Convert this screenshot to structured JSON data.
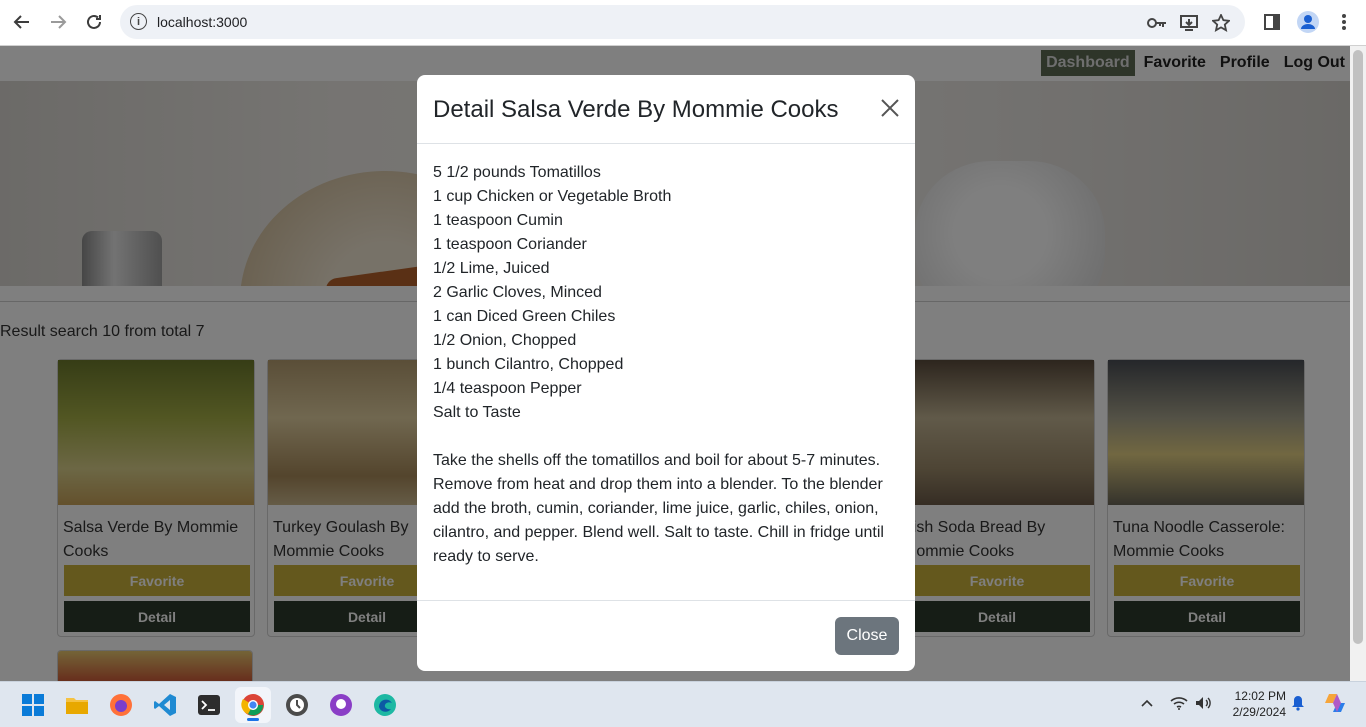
{
  "browser": {
    "url": "localhost:3000",
    "icons": {
      "back": "arrow-left-icon",
      "forward": "arrow-right-icon",
      "reload": "reload-icon",
      "info": "info-icon",
      "key": "key-icon",
      "install": "install-app-icon",
      "bookmark": "star-icon",
      "sidepanel": "side-panel-icon",
      "profile": "profile-icon",
      "menu": "kebab-menu-icon"
    }
  },
  "nav": {
    "items": [
      {
        "label": "Dashboard",
        "active": true
      },
      {
        "label": "Favorite",
        "active": false
      },
      {
        "label": "Profile",
        "active": false
      },
      {
        "label": "Log Out",
        "active": false
      }
    ]
  },
  "results": {
    "text": "Result search 10 from total 7"
  },
  "cards": [
    {
      "title": "Salsa Verde By Mommie Cooks",
      "favorite": "Favorite",
      "detail": "Detail",
      "thumb_color": "#8a9a3a"
    },
    {
      "title": "Turkey Goulash By Mommie Cooks",
      "favorite": "Favorite",
      "detail": "Detail",
      "thumb_color": "#c9b488"
    },
    {
      "title": "Irish Soda Bread By Mommie Cooks",
      "favorite": "Favorite",
      "detail": "Detail",
      "thumb_color": "#8a7c68"
    },
    {
      "title": "Tuna Noodle Casserole: Mommie Cooks",
      "favorite": "Favorite",
      "detail": "Detail",
      "thumb_color": "#b8a878"
    }
  ],
  "modal": {
    "title": "Detail Salsa Verde By Mommie Cooks",
    "ingredients": [
      "5 1/2 pounds Tomatillos",
      "1 cup Chicken or Vegetable Broth",
      "1 teaspoon Cumin",
      "1 teaspoon Coriander",
      "1/2 Lime, Juiced",
      "2 Garlic Cloves, Minced",
      "1 can Diced Green Chiles",
      "1/2 Onion, Chopped",
      "1 bunch Cilantro, Chopped",
      "1/4 teaspoon Pepper",
      "Salt to Taste"
    ],
    "instructions": "Take the shells off the tomatillos and boil for about 5-7 minutes. Remove from heat and drop them into a blender. To the blender add the broth, cumin, coriander, lime juice, garlic, chiles, onion, cilantro, and pepper. Blend well. Salt to taste. Chill in fridge until ready to serve.",
    "close_label": "Close"
  },
  "taskbar": {
    "apps": [
      "windows-start-icon",
      "file-explorer-icon",
      "firefox-icon",
      "vscode-icon",
      "terminal-icon",
      "chrome-icon",
      "app-icon",
      "github-desktop-icon",
      "edge-icon"
    ],
    "time": "12:02 PM",
    "date": "2/29/2024"
  }
}
